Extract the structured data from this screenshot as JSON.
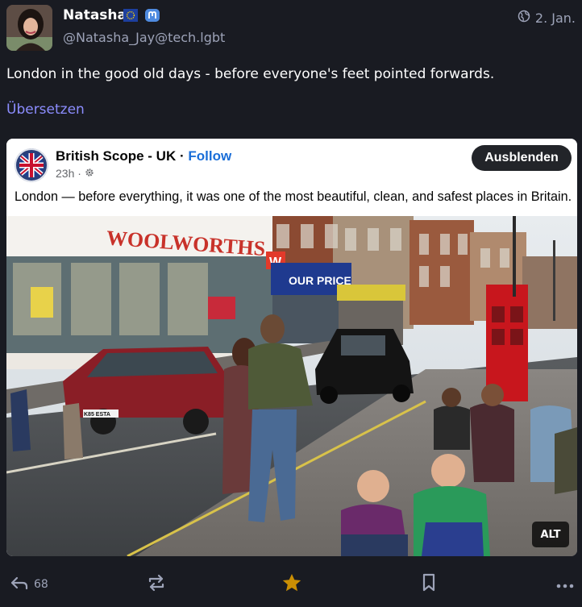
{
  "author": {
    "display_name": "Natasha",
    "handle": "@Natasha_Jay@tech.lgbt",
    "badges": [
      "eu-flag-icon",
      "mastodon-icon"
    ]
  },
  "post": {
    "date": "2. Jan.",
    "text": "London in the good old days - before everyone's feet pointed forwards.",
    "translate_label": "Übersetzen"
  },
  "embedded_screenshot": {
    "page_name": "British Scope - UK",
    "separator": " · ",
    "follow_label": "Follow",
    "time": "23h ·",
    "caption": "London — before everything, it was one of the most beautiful, clean, and safest places in Britain.",
    "hide_label": "Ausblenden",
    "photo_texts": {
      "store_sign": "WOOLWORTHS",
      "w_sign": "W",
      "our_price": "OUR PRICE",
      "plate": "K85 ESTA"
    }
  },
  "media": {
    "alt_label": "ALT"
  },
  "actions": {
    "reply_count": "68"
  },
  "colors": {
    "background": "#191b22",
    "secondary_text": "#9da3b8",
    "link": "#8c8dff",
    "favourite": "#ca8f04",
    "follow": "#1a6ed8"
  }
}
